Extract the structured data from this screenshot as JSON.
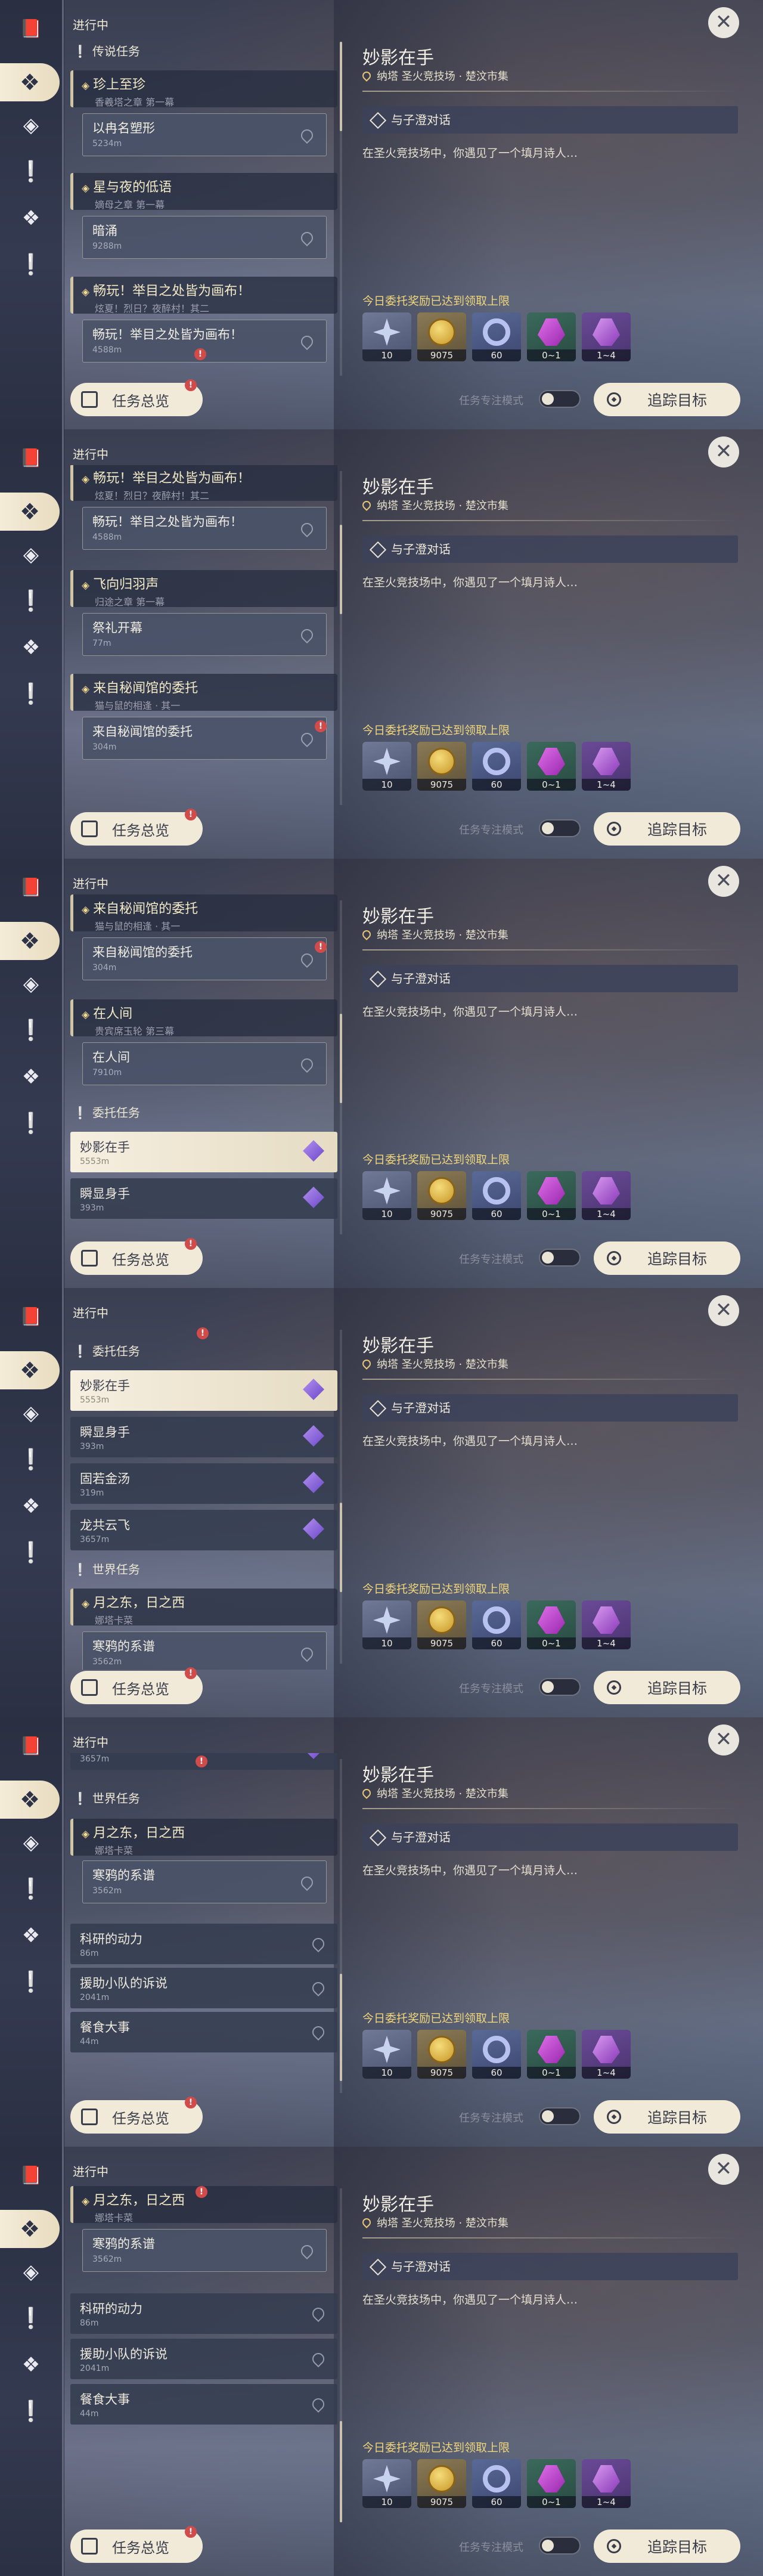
{
  "ui": {
    "status": "进行中",
    "overview_label": "任务总览",
    "overview_badge": "!",
    "focus_label": "任务专注模式",
    "track_label": "追踪目标",
    "close_glyph": "✕"
  },
  "sections": {
    "legend": "传说任务",
    "commission": "委托任务",
    "world": "世界任务"
  },
  "detail": {
    "title": "妙影在手",
    "location": "纳塔  圣火竞技场 · 楚汶市集",
    "objective": "与子澄对话",
    "description": "在圣火竞技场中，你遇见了一个填月诗人…",
    "reward_notice": "今日委托奖励已达到领取上限",
    "rewards": [
      {
        "icon": "star-icon",
        "value": "10"
      },
      {
        "icon": "mora-coin-icon",
        "value": "9075"
      },
      {
        "icon": "ring-icon",
        "value": "60"
      },
      {
        "icon": "crystal-icon",
        "value": "0~1"
      },
      {
        "icon": "crystal-cluster-icon",
        "value": "1~4"
      }
    ]
  },
  "quests": {
    "zhuyushengzhu": {
      "title": "珍上至珍",
      "subtitle": "香羲塔之章 第一幕"
    },
    "yiwumingzhuangxing": {
      "title": "以冉名塑形",
      "dist": "5234m"
    },
    "xingyeyeyu": {
      "title": "星与夜的低语",
      "subtitle": "嫡母之章 第一幕"
    },
    "anyong": {
      "title": "暗涌",
      "dist": "9288m"
    },
    "changwan": {
      "title": "畅玩！举目之处皆为画布！",
      "subtitle": "炫夏！烈日？夜醉村！其二"
    },
    "changwan_sub": {
      "title": "畅玩！举目之处皆为画布！",
      "dist": "4588m"
    },
    "feixiang": {
      "title": "飞向归羽声",
      "subtitle": "归途之章 第一幕"
    },
    "jilikaimu": {
      "title": "祭礼开幕",
      "dist": "77m"
    },
    "mimiwenguan": {
      "title": "来自秘闻馆的委托",
      "subtitle": "猫与鼠的相逢 · 其一"
    },
    "mimiwenguan_sub": {
      "title": "来自秘闻馆的委托",
      "dist": "304m"
    },
    "zairenjian": {
      "title": "在人间",
      "subtitle": "贵宾席玉轮 第三幕"
    },
    "zairenjian_sub": {
      "title": "在人间",
      "dist": "7910m"
    },
    "yueezhidong": {
      "title": "月之东，日之西",
      "subtitle": "娜塔卡菜"
    },
    "hanyadeshengu": {
      "title": "寒鸦的系谱",
      "dist_a": "3562m",
      "dist_b": "3562m"
    }
  },
  "commissions": [
    {
      "title": "妙影在手",
      "dist": "5553m"
    },
    {
      "title": "瞬显身手",
      "dist": "393m"
    },
    {
      "title": "固若金汤",
      "dist": "319m"
    },
    {
      "title": "龙共云飞",
      "dist": "3657m"
    }
  ],
  "world_items": [
    {
      "title": "科研的动力",
      "dist": "86m"
    },
    {
      "title": "援助小队的诉说",
      "dist": "2041m"
    },
    {
      "title": "餐食大事",
      "dist": "44m"
    }
  ]
}
